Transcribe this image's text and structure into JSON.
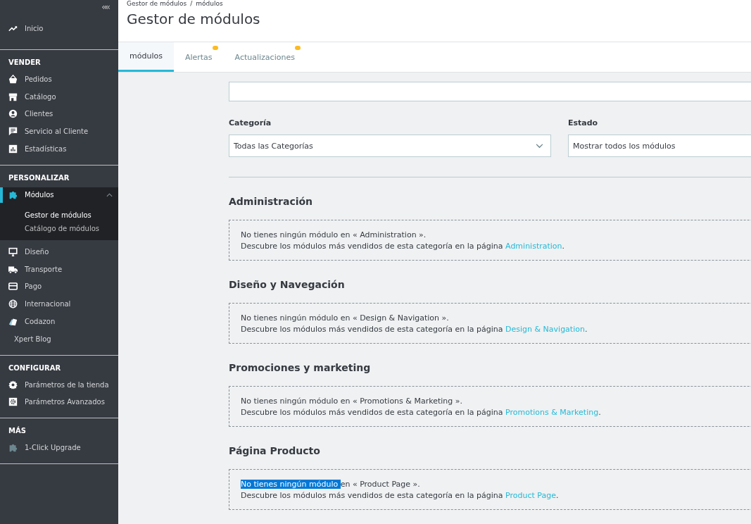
{
  "sidebar": {
    "collapse_label": "«",
    "home": {
      "label": "Inicio"
    },
    "groups": [
      {
        "title": "VENDER",
        "items": [
          {
            "label": "Pedidos",
            "selected": false
          },
          {
            "label": "Catálogo",
            "selected": false
          },
          {
            "label": "Clientes",
            "selected": false
          },
          {
            "label": "Servicio al Cliente",
            "selected": false
          },
          {
            "label": "Estadísticas",
            "selected": false
          }
        ]
      },
      {
        "title": "PERSONALIZAR",
        "items": [
          {
            "label": "Módulos",
            "selected": true,
            "expanded": true,
            "children": [
              {
                "label": "Gestor de módulos",
                "selected": true
              },
              {
                "label": "Catálogo de módulos",
                "selected": false
              }
            ]
          },
          {
            "label": "Diseño",
            "selected": false
          },
          {
            "label": "Transporte",
            "selected": false
          },
          {
            "label": "Pago",
            "selected": false
          },
          {
            "label": "Internacional",
            "selected": false
          },
          {
            "label": "Codazon",
            "selected": false
          },
          {
            "label": "Xpert Blog",
            "selected": false
          }
        ]
      },
      {
        "title": "CONFIGURAR",
        "items": [
          {
            "label": "Parámetros de la tienda",
            "selected": false
          },
          {
            "label": "Parámetros Avanzados",
            "selected": false
          }
        ]
      },
      {
        "title": "MÁS",
        "items": [
          {
            "label": "1-Click Upgrade",
            "selected": false
          }
        ]
      }
    ]
  },
  "breadcrumb": [
    "Gestor de módulos",
    "módulos"
  ],
  "breadcrumb_separator": "/",
  "page_title": "Gestor de módulos",
  "tabs": [
    {
      "label": "módulos",
      "selected": true,
      "badge": false
    },
    {
      "label": "Alertas",
      "selected": false,
      "badge": true
    },
    {
      "label": "Actualizaciones",
      "selected": false,
      "badge": true
    }
  ],
  "filters": [
    {
      "label": "Categoría",
      "value": "Todas las Categorías"
    },
    {
      "label": "Estado",
      "value": "Mostrar todos los módulos"
    }
  ],
  "sections": [
    {
      "title": "Administración",
      "message": [
        {
          "text": "No tienes ningún módulo en « Administration ».",
          "selected": false
        }
      ],
      "discover": "Descubre los módulos más vendidos de esta categoría en la página ",
      "link": "Administration",
      "end": "."
    },
    {
      "title": "Diseño y Navegación",
      "message": [
        {
          "text": "No tienes ningún módulo en « Design & Navigation ».",
          "selected": false
        }
      ],
      "discover": "Descubre los módulos más vendidos de esta categoría en la página ",
      "link": "Design & Navigation",
      "end": "."
    },
    {
      "title": "Promociones y marketing",
      "message": [
        {
          "text": "No tienes ningún módulo en « Promotions & Marketing ».",
          "selected": false
        }
      ],
      "discover": "Descubre los módulos más vendidos de esta categoría en la página ",
      "link": "Promotions & Marketing",
      "end": "."
    },
    {
      "title": "Página Producto",
      "message": [
        {
          "text": "No tienes ningún módulo ",
          "selected": true
        },
        {
          "text": "en « Product Page ».",
          "selected": false
        }
      ],
      "discover": "Descubre los módulos más vendidos de esta categoría en la página ",
      "link": "Product Page",
      "end": "."
    }
  ]
}
